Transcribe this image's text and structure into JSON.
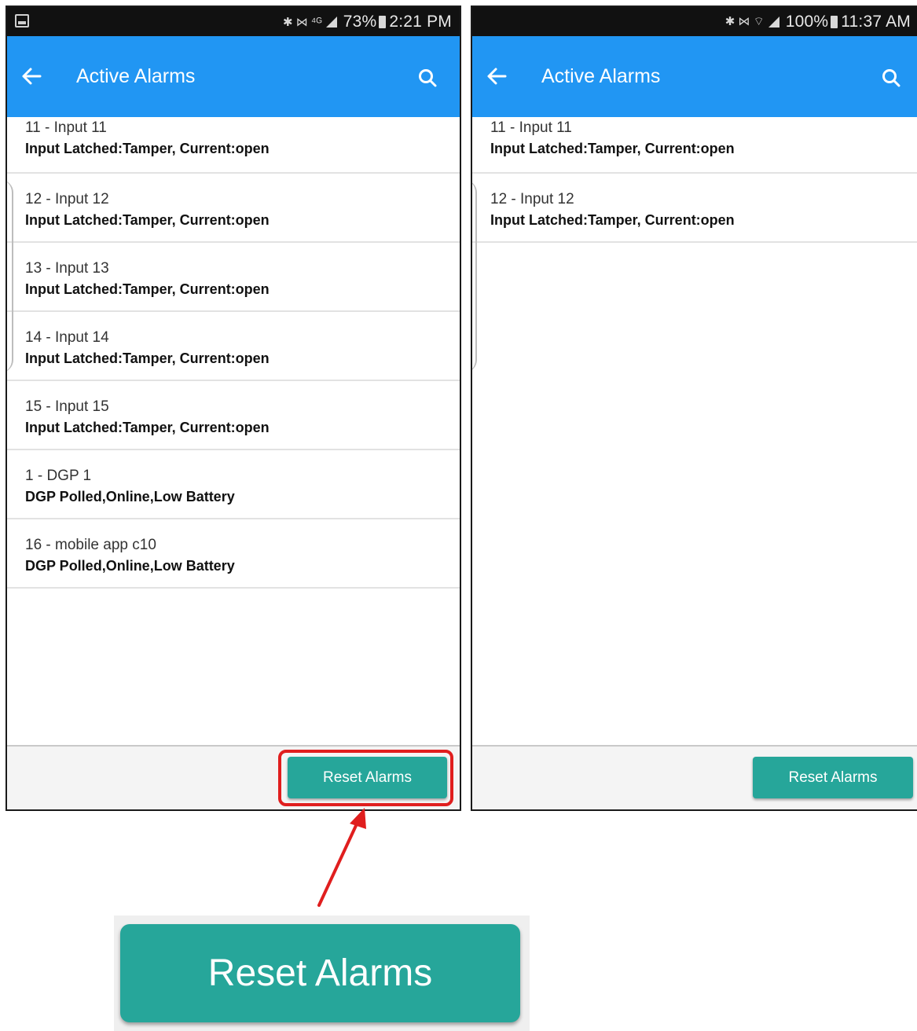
{
  "left_phone": {
    "status": {
      "icons": "✱ ⋈ ⁴ᴳ",
      "battery": "73%",
      "time": "2:21 PM"
    },
    "app_bar": {
      "title": "Active Alarms",
      "back_icon": "arrow-left",
      "search_icon": "search"
    },
    "alarms": [
      {
        "name": "11 - Input 11",
        "detail": "Input Latched:Tamper, Current:open"
      },
      {
        "name": "12 - Input 12",
        "detail": "Input Latched:Tamper, Current:open"
      },
      {
        "name": "13 - Input 13",
        "detail": "Input Latched:Tamper, Current:open"
      },
      {
        "name": "14 - Input 14",
        "detail": "Input Latched:Tamper, Current:open"
      },
      {
        "name": "15 - Input 15",
        "detail": "Input Latched:Tamper, Current:open"
      },
      {
        "name": "1 - DGP 1",
        "detail": "DGP Polled,Online,Low Battery"
      },
      {
        "name": "16 - mobile app c10",
        "detail": "DGP Polled,Online,Low Battery"
      }
    ],
    "reset_label": "Reset Alarms"
  },
  "right_phone": {
    "status": {
      "icons": "✱ ⋈ ⌔",
      "battery": "100%",
      "time": "11:37 AM"
    },
    "app_bar": {
      "title": "Active Alarms",
      "back_icon": "arrow-left",
      "search_icon": "search"
    },
    "alarms": [
      {
        "name": "11 - Input 11",
        "detail": "Input Latched:Tamper, Current:open"
      },
      {
        "name": "12 - Input 12",
        "detail": "Input Latched:Tamper, Current:open"
      }
    ],
    "reset_label": "Reset Alarms"
  },
  "callout": {
    "zoom_label": "Reset Alarms"
  },
  "colors": {
    "app_bar": "#2196f3",
    "button": "#26a69a",
    "highlight": "#e01e1e",
    "status_bar": "#111111"
  }
}
